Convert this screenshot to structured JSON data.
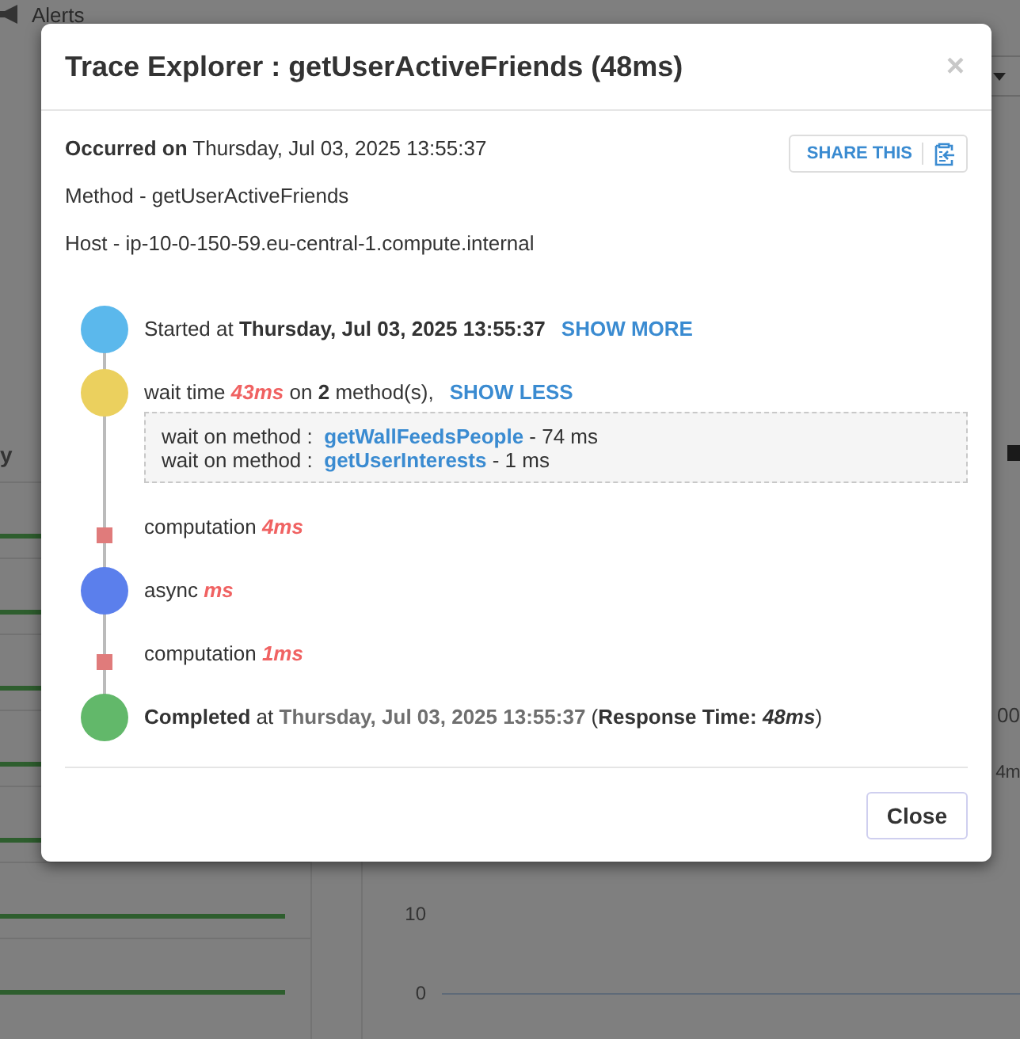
{
  "background": {
    "top_bar_title": "Alerts",
    "left_label": "y",
    "fragments": [
      "00",
      "4m"
    ],
    "axis_ticks": [
      "10",
      "0"
    ]
  },
  "modal": {
    "title": "Trace Explorer : getUserActiveFriends (48ms)",
    "close": "×",
    "occurred": "**Occurred on** Thursday, Jul 03, 2025 13:55:37",
    "share_button": "SHARE THIS",
    "method_line": "Method - getUserActiveFriends",
    "host_line": "Host - ip-10-0-150-59.eu-central-1.compute.internal",
    "timeline": [
      {
        "kind": "start",
        "color": "#5bb8ec",
        "text": "Started at **Thursday, Jul 03, 2025 13:55:37**",
        "link": "SHOW MORE"
      },
      {
        "kind": "wait",
        "color": "#ebd05e",
        "text": "wait time *43ms* on **2** method(s),",
        "link": "SHOW LESS",
        "expanded": true,
        "details": [
          {
            "label": "wait on method :",
            "method": "getWallFeedsPeople",
            "time": "- 74 ms"
          },
          {
            "label": "wait on method :",
            "method": "getUserInterests",
            "time": "- 1 ms"
          }
        ]
      },
      {
        "kind": "computation",
        "color": "#e07b7b",
        "text": "computation *4ms*"
      },
      {
        "kind": "async",
        "color": "#5b7fec",
        "text": "async *ms*"
      },
      {
        "kind": "computation",
        "color": "#e07b7b",
        "text": "computation *1ms*"
      },
      {
        "kind": "end",
        "color": "#62b86a",
        "text": "**Completed** at **Thursday, Jul 03, 2025 13:55:37** (**Response Time:** *48ms*)"
      }
    ],
    "footer_button": "Close"
  }
}
